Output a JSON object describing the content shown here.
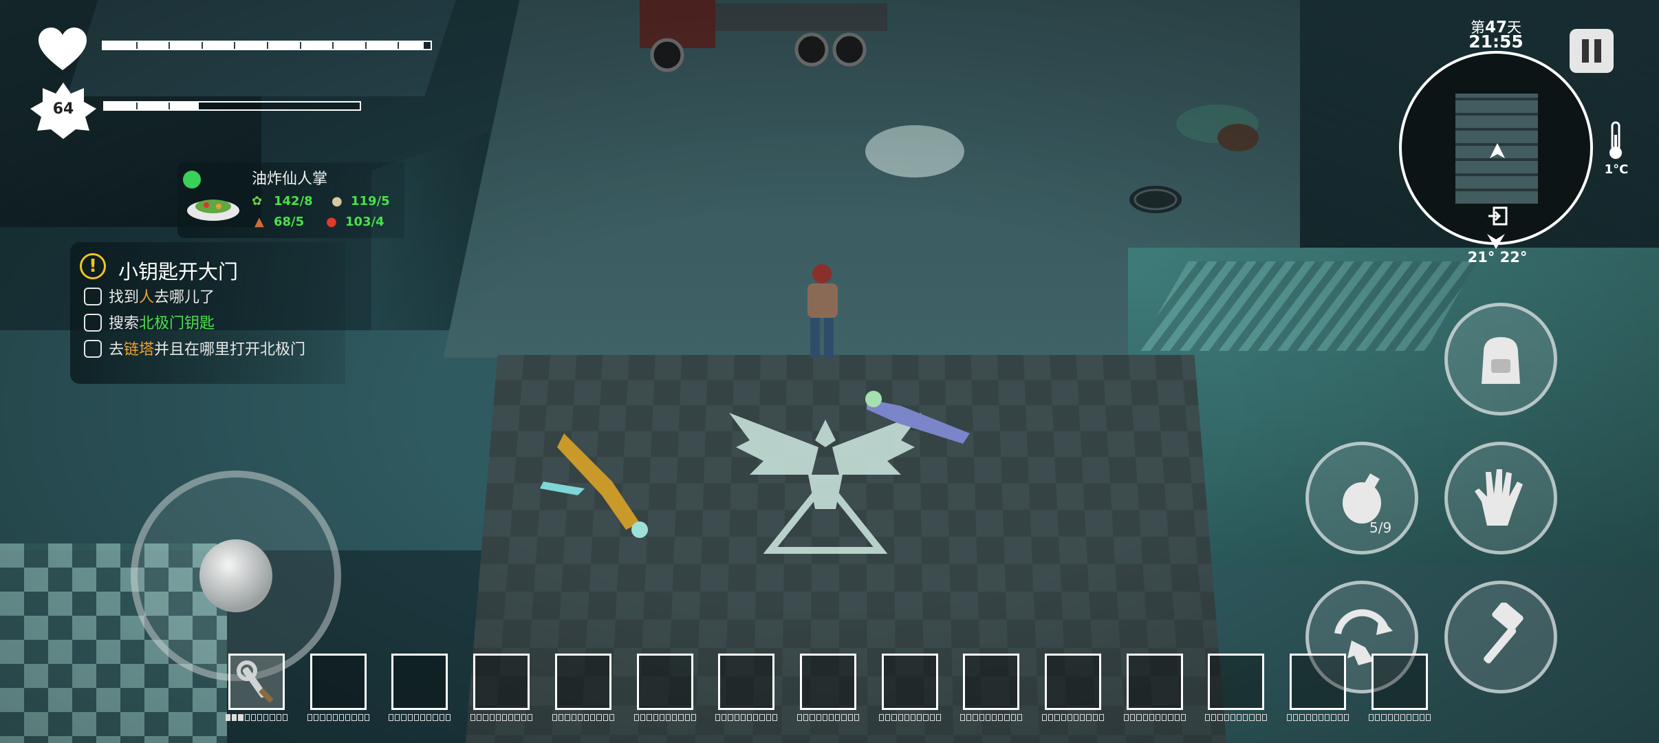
{
  "hud": {
    "health": {
      "icon": "heart-icon",
      "fill_fraction": 0.98,
      "segments": 10
    },
    "level": {
      "value": "64",
      "icon": "star-badge-icon",
      "xp_fraction": 0.37
    }
  },
  "recipe": {
    "name": "油炸仙人掌",
    "status_color": "#39d15a",
    "stats": [
      {
        "icon": "herb-icon",
        "value": "142/8"
      },
      {
        "icon": "onion-icon",
        "value": "119/5"
      },
      {
        "icon": "meat-icon",
        "value": "68/5"
      },
      {
        "icon": "tomato-icon",
        "value": "103/4"
      }
    ]
  },
  "quest": {
    "title": "小钥匙开大门",
    "tasks": [
      {
        "parts": [
          "找到",
          "人",
          "去哪儿了"
        ]
      },
      {
        "parts": [
          "搜索",
          "北极门钥匙",
          ""
        ]
      },
      {
        "parts": [
          "去",
          "链塔",
          "并且在哪里打开北极门"
        ]
      }
    ]
  },
  "clock": {
    "day_prefix": "第",
    "day_num": "47",
    "day_suffix": "天",
    "time": "21:55"
  },
  "minimap": {
    "coords": "21° 22°",
    "exit_icon": "exit-door-icon",
    "player_icon": "player-arrow-icon"
  },
  "temperature": {
    "value": "1°C",
    "icon": "thermometer-icon"
  },
  "actions": {
    "backpack": {
      "icon": "backpack-icon"
    },
    "grenade": {
      "icon": "grenade-icon",
      "count": "5/9"
    },
    "interact": {
      "icon": "hand-icon"
    },
    "dodge": {
      "icon": "dodge-roll-icon"
    },
    "attack": {
      "icon": "hammer-icon"
    },
    "pause": {
      "icon": "pause-icon"
    }
  },
  "joystick": {
    "icon": "joystick-knob"
  },
  "hotbar": {
    "slots": 15,
    "first_item_icon": "wrench-tool-icon",
    "first_item_durability": 0.3
  },
  "colors": {
    "accent_green": "#4be04b",
    "accent_orange": "#f0a030",
    "warn_yellow": "#f3c51c"
  }
}
